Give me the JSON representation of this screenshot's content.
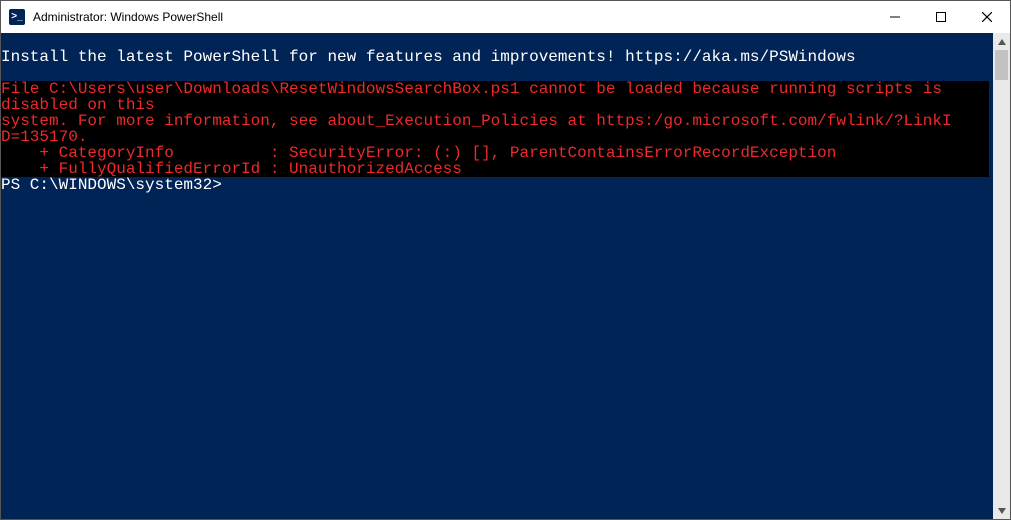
{
  "titlebar": {
    "icon_text": ">_",
    "title": "Administrator: Windows PowerShell"
  },
  "terminal": {
    "info_line": "Install the latest PowerShell for new features and improvements! https://aka.ms/PSWindows",
    "error_lines": [
      "File C:\\Users\\user\\Downloads\\ResetWindowsSearchBox.ps1 cannot be loaded because running scripts is",
      "disabled on this",
      "system. For more information, see about_Execution_Policies at https:/go.microsoft.com/fwlink/?LinkI",
      "D=135170.",
      "    + CategoryInfo          : SecurityError: (:) [], ParentContainsErrorRecordException",
      "    + FullyQualifiedErrorId : UnauthorizedAccess"
    ],
    "prompt": "PS C:\\WINDOWS\\system32>"
  },
  "colors": {
    "terminal_bg": "#012456",
    "error_fg": "#ef2929",
    "error_bg": "#000000",
    "text_fg": "#ffffff"
  }
}
